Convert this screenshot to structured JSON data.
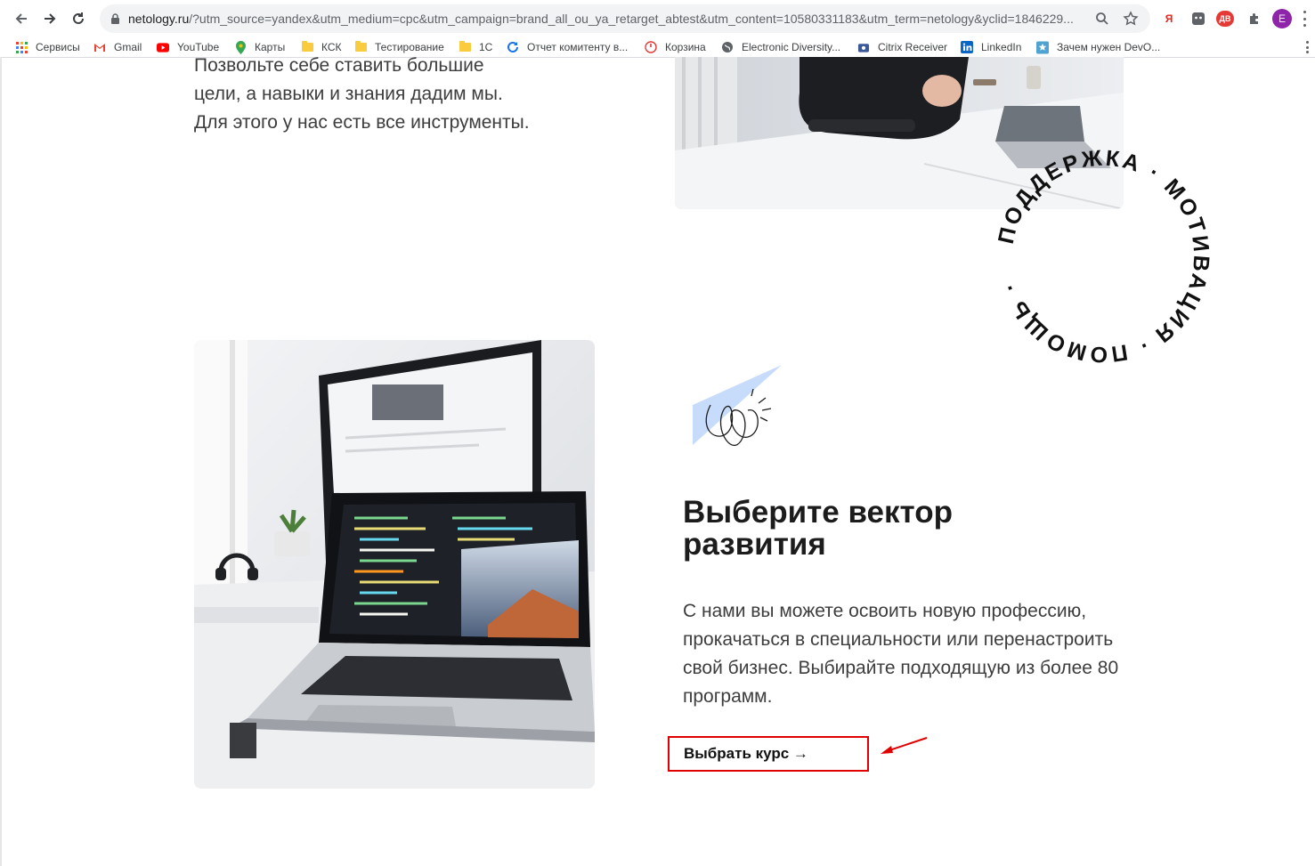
{
  "browser": {
    "url_domain": "netology.ru",
    "url_rest": "/?utm_source=yandex&utm_medium=cpc&utm_campaign=brand_all_ou_ya_retarget_abtest&utm_content=10580331183&utm_term=netology&yclid=1846229...",
    "profile_initial": "E",
    "extensions": [
      "Я",
      "⚇",
      "ДВ"
    ]
  },
  "bookmarks": [
    {
      "label": "Сервисы",
      "icon": "apps-grid-icon"
    },
    {
      "label": "Gmail",
      "icon": "gmail-icon"
    },
    {
      "label": "YouTube",
      "icon": "youtube-icon"
    },
    {
      "label": "Карты",
      "icon": "maps-pin-icon"
    },
    {
      "label": "КСК",
      "icon": "folder-icon"
    },
    {
      "label": "Тестирование",
      "icon": "folder-icon"
    },
    {
      "label": "1С",
      "icon": "folder-icon"
    },
    {
      "label": "Отчет комитенту в...",
      "icon": "refresh-circle-icon"
    },
    {
      "label": "Корзина",
      "icon": "power-icon"
    },
    {
      "label": "Electronic Diversity...",
      "icon": "globe-icon"
    },
    {
      "label": "Citrix Receiver",
      "icon": "citrix-icon"
    },
    {
      "label": "LinkedIn",
      "icon": "linkedin-icon"
    },
    {
      "label": "Зачем нужен DevO...",
      "icon": "star-badge-icon"
    }
  ],
  "intro": {
    "lines": [
      "Позвольте себе ставить большие",
      "цели, а навыки и знания дадим мы.",
      "Для этого у нас есть все инструменты."
    ]
  },
  "stamp": {
    "text": "ПОДДЕРЖКА · МОТИВАЦИЯ · ПОМОЩЬ · "
  },
  "section": {
    "title": "Выберите вектор развития",
    "text": "С нами вы можете освоить новую профессию, прокачаться в специальности или перенастроить свой бизнес. Выбирайте подходящую из более 80 программ.",
    "cta_label": "Выбрать курс →"
  },
  "colors": {
    "accent_annotation": "#e00000",
    "doodle_blue": "#c7dbfb",
    "text": "#3d3d3d"
  }
}
